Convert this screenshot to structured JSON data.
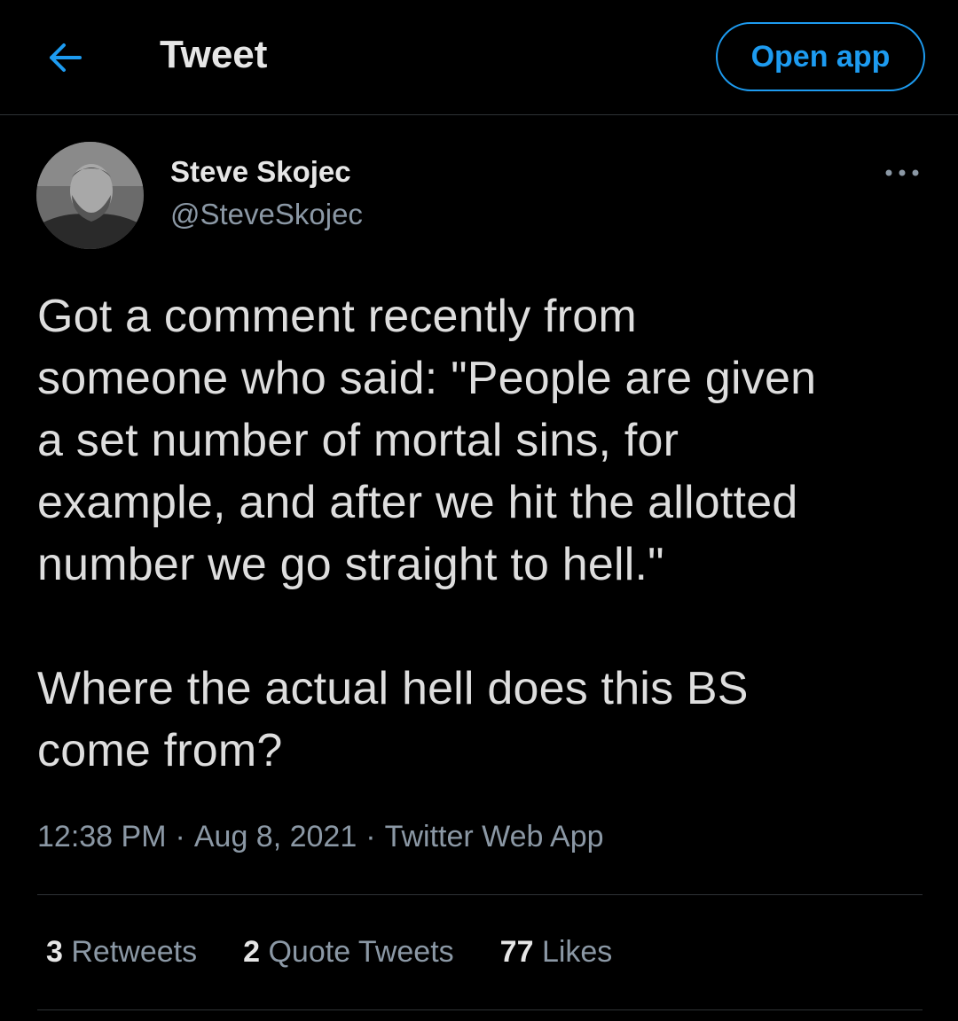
{
  "header": {
    "title": "Tweet",
    "open_app_label": "Open app"
  },
  "author": {
    "name": "Steve Skojec",
    "handle": "@SteveSkojec"
  },
  "tweet": {
    "text": "Got a comment recently from\nsomeone who said: \"People are given\na set number of mortal sins, for\nexample, and after we hit the allotted\nnumber we go straight to hell.\"\n\nWhere the actual hell does this BS\ncome from?",
    "time": "12:38 PM",
    "date": "Aug 8, 2021",
    "source": "Twitter Web App",
    "separator": "·"
  },
  "stats": {
    "retweets_count": "3",
    "retweets_label": "Retweets",
    "quotes_count": "2",
    "quotes_label": "Quote Tweets",
    "likes_count": "77",
    "likes_label": "Likes"
  },
  "colors": {
    "background": "#000000",
    "accent": "#1d9bf0",
    "secondary_text": "#8b98a5",
    "divider": "#2f3336"
  },
  "icons": {
    "back": "arrow-left-icon",
    "more": "more-horizontal-icon"
  }
}
